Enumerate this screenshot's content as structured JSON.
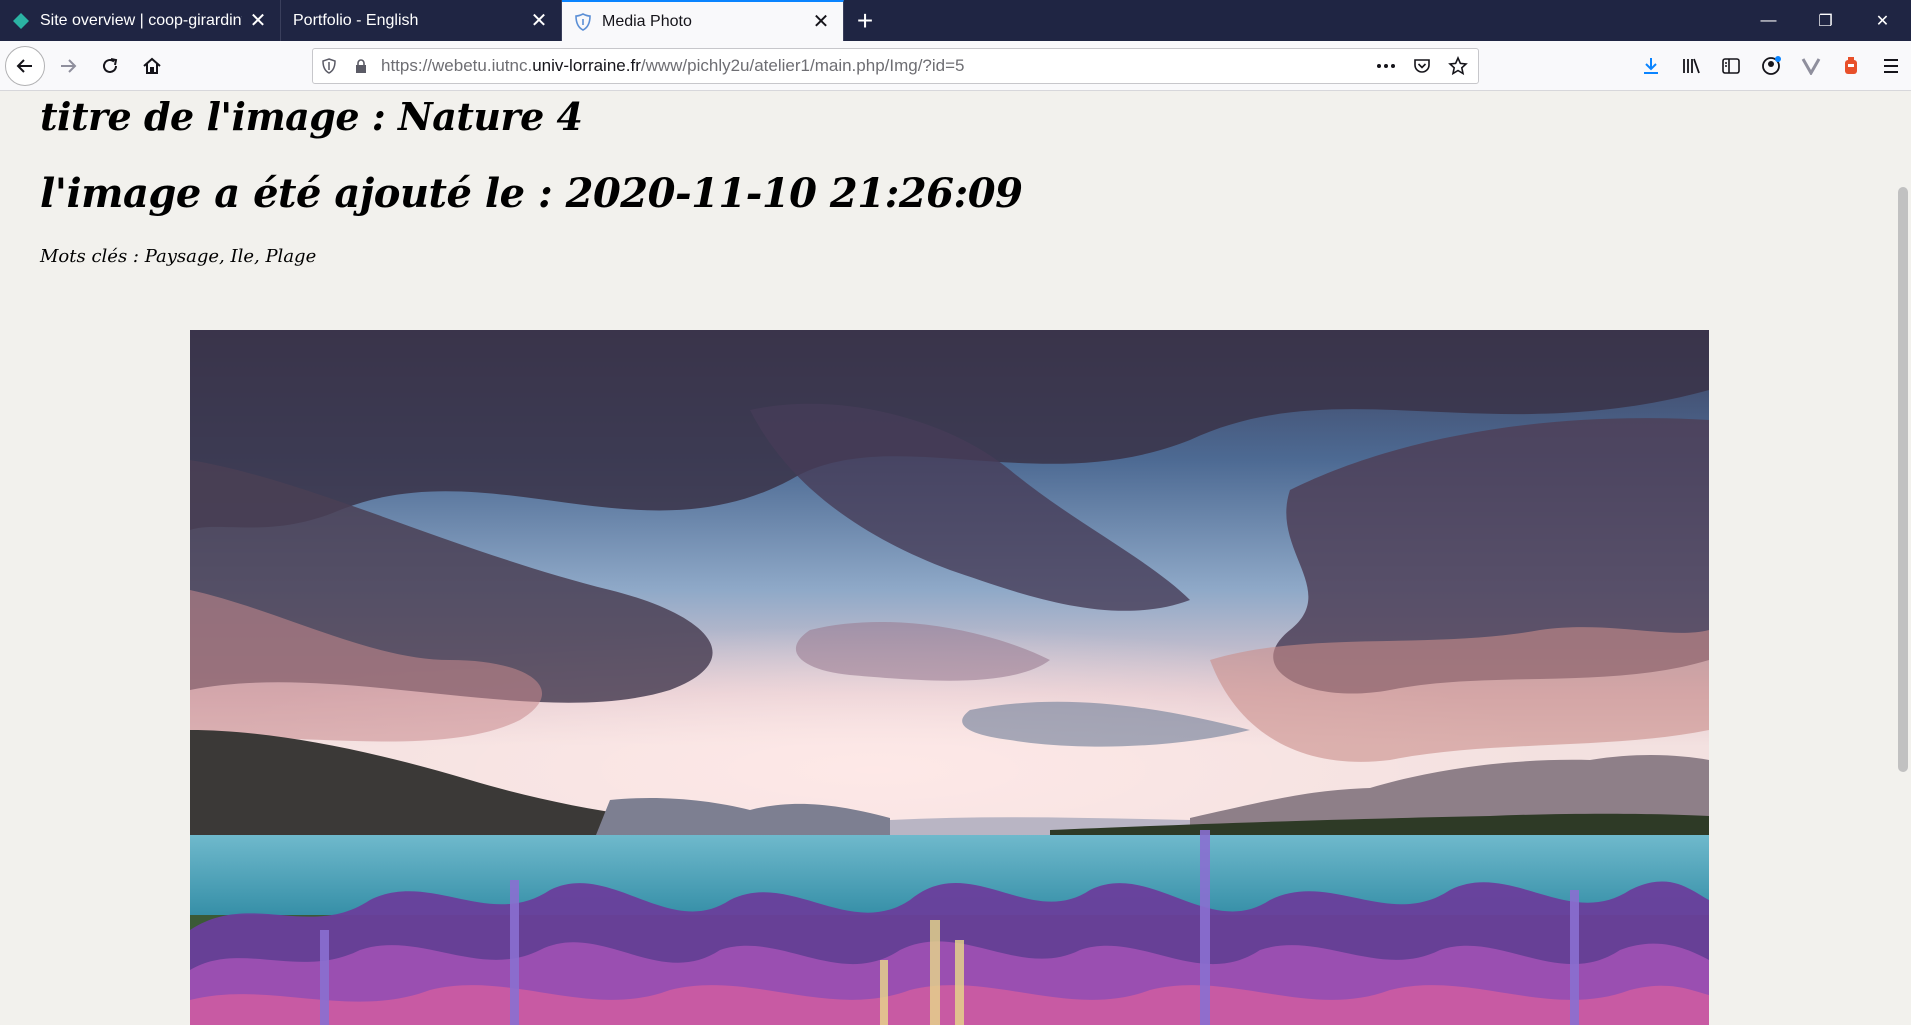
{
  "tabs": [
    {
      "title": "Site overview | coop-girardinvil",
      "icon": "diamond-icon",
      "color": "#2bb3a3"
    },
    {
      "title": "Portfolio - English",
      "icon": "",
      "color": ""
    },
    {
      "title": "Media Photo",
      "icon": "shield-heart-icon",
      "color": "#5b8fd6"
    }
  ],
  "url": {
    "prefix": "https://webetu.iutnc.",
    "domain": "univ-lorraine.fr",
    "path": "/www/pichly2u/atelier1/main.php/Img/?id=5"
  },
  "page": {
    "title": "titre de l'image : Nature 4",
    "date": "l'image a été ajouté le : 2020-11-10 21:26:09",
    "keywords": "Mots clés : Paysage, Ile, Plage"
  },
  "colors": {
    "tabstrip": "#1f2543",
    "accent": "#0a84ff",
    "download": "#0a84ff",
    "page_bg": "#f2f1ed"
  }
}
